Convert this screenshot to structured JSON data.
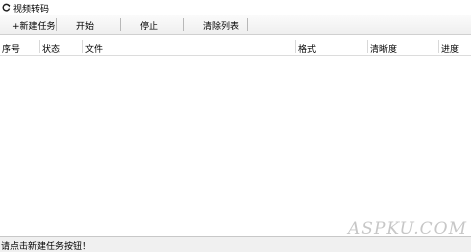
{
  "window": {
    "title": "视频转码",
    "icon": "app-refresh-icon"
  },
  "toolbar": {
    "new_task": "+新建任务",
    "start": "开始",
    "stop": "停止",
    "clear_list": "清除列表"
  },
  "list": {
    "columns": [
      "序号",
      "状态",
      "文件",
      "格式",
      "清晰度",
      "进度"
    ],
    "rows": []
  },
  "statusbar": {
    "message": "请点击新建任务按钮！"
  },
  "watermark": "ASPKU.COM"
}
